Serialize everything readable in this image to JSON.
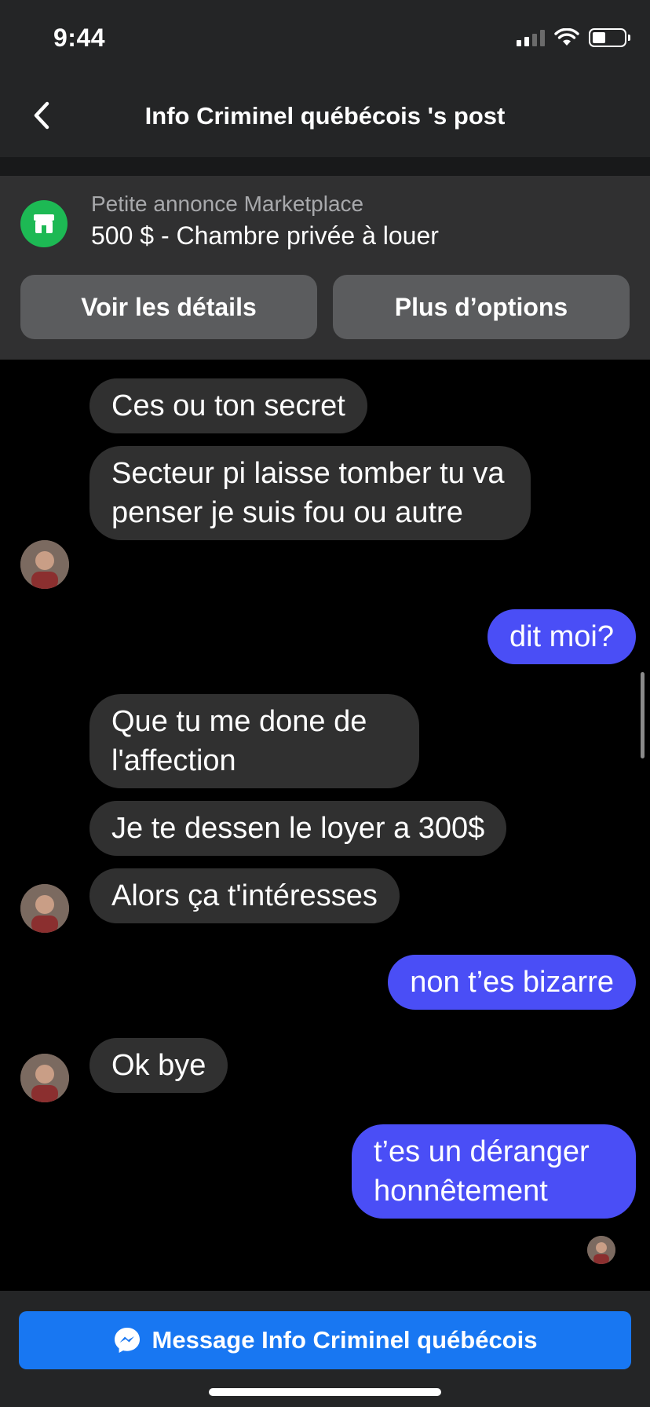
{
  "status_bar": {
    "time": "9:44"
  },
  "header": {
    "title": "Info Criminel québécois 's post",
    "back_icon": "chevron-left-icon"
  },
  "marketplace": {
    "subtitle": "Petite annonce Marketplace",
    "title": "500 $ - Chambre privée à louer",
    "icon": "storefront-icon",
    "icon_color": "#1db954",
    "details_button": "Voir les détails",
    "options_button": "Plus d’options"
  },
  "messages": [
    {
      "direction": "incoming",
      "text": "Ces ou ton secret"
    },
    {
      "direction": "incoming",
      "text": "Secteur pi laisse tomber tu va penser je suis fou ou autre"
    },
    {
      "direction": "outgoing",
      "text": "dit moi?"
    },
    {
      "direction": "incoming",
      "text": "Que tu me done de l'affection"
    },
    {
      "direction": "incoming",
      "text": "Je te dessen le loyer a 300$"
    },
    {
      "direction": "incoming",
      "text": "Alors ça t'intéresses"
    },
    {
      "direction": "outgoing",
      "text": "non t’es bizarre"
    },
    {
      "direction": "incoming",
      "text": "Ok bye"
    },
    {
      "direction": "outgoing",
      "text": "t’es un déranger honnêtement"
    }
  ],
  "bottom": {
    "message_button": "Message Info Criminel québécois",
    "icon": "messenger-icon",
    "button_color": "#1877f2"
  },
  "colors": {
    "outgoing_bubble": "#4a4ef6",
    "incoming_bubble": "#303030",
    "background": "#000000"
  }
}
